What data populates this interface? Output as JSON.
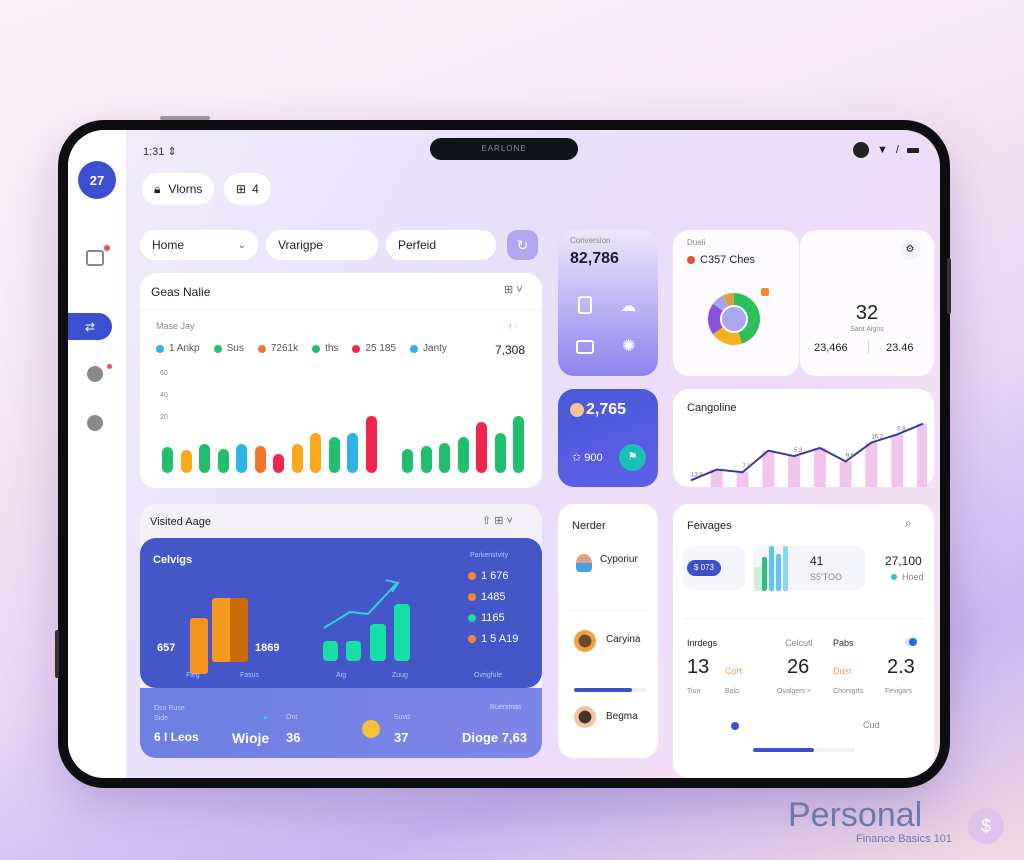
{
  "status_bar": {
    "time": "1:31",
    "notch_label": "EARLONE"
  },
  "sidebar": {
    "avatar_text": "27",
    "items": [
      {
        "icon": "gallery-icon",
        "badge": true
      },
      {
        "icon": "sync-icon",
        "active": true
      },
      {
        "icon": "chat-icon",
        "badge": true
      },
      {
        "icon": "pin-icon"
      }
    ]
  },
  "top_tabs": [
    {
      "label": "Vlorns",
      "icon": "lock-icon"
    },
    {
      "label": "4",
      "icon": "grid-icon"
    }
  ],
  "filters": {
    "home": {
      "label": "Home"
    },
    "vrange": {
      "label": "Vrarigpe"
    },
    "period": {
      "label": "Perfeid"
    }
  },
  "gross_card": {
    "title": "Geas Nalie",
    "subtitle": "Mase Jay",
    "total": "7,308",
    "legend": [
      {
        "label": "1 Ankp",
        "color": "#2cb5e6"
      },
      {
        "label": "Sus",
        "color": "#22c06a"
      },
      {
        "label": "7261k",
        "color": "#f4762a"
      },
      {
        "label": "ths",
        "color": "#22c06a"
      },
      {
        "label": "25 185",
        "color": "#f0264f"
      },
      {
        "label": "Janty",
        "color": "#2cb5e6"
      }
    ],
    "y_ticks": [
      "60",
      "40",
      "20"
    ]
  },
  "chart_data": {
    "type": "bar",
    "title": "Geas Nalie",
    "ylim": [
      0,
      70
    ],
    "groups": [
      {
        "values": [
          18,
          16,
          20,
          17,
          20,
          19,
          13,
          20,
          28,
          25,
          28,
          40
        ],
        "colors": [
          "#1fbf6e",
          "#f7a81b",
          "#1fbf6e",
          "#1fbf6e",
          "#2cb5e6",
          "#f4762a",
          "#f0264f",
          "#f7a81b",
          "#f7a81b",
          "#1fbf6e",
          "#2cb5e6",
          "#f0264f"
        ]
      },
      {
        "values": [
          17,
          19,
          21,
          25,
          36,
          28,
          40
        ],
        "colors": [
          "#1fbf6e",
          "#1fbf6e",
          "#1fbf6e",
          "#1fbf6e",
          "#f0264f",
          "#1fbf6e",
          "#1fbf6e"
        ]
      }
    ]
  },
  "conversion_card": {
    "label": "Conversion",
    "value": "82,786"
  },
  "donut_card": {
    "label": "Dueli",
    "title": "C357 Ches",
    "segments": [
      {
        "value": 45,
        "color": "#2fbf5a"
      },
      {
        "value": 20,
        "color": "#f7b21d"
      },
      {
        "value": 20,
        "color": "#8b4fe0"
      },
      {
        "value": 8,
        "color": "#a8a4f0"
      },
      {
        "value": 7,
        "color": "#d9a23a"
      }
    ]
  },
  "stat_card": {
    "value": "32",
    "caption": "Sant Aigns",
    "left": "23,466",
    "right": "23.46"
  },
  "blue_card": {
    "value": "2,765",
    "sub_value": "900"
  },
  "line_card": {
    "title": "Cangoline",
    "points": [
      2,
      10,
      8,
      24,
      20,
      26,
      16,
      30,
      36,
      44
    ],
    "labels": [
      "13.8",
      "7.0",
      "5.8",
      "9.6",
      "16.2",
      "5.8"
    ]
  },
  "visited_card": {
    "title": "Visited Aage",
    "panel_title": "Celvigs",
    "panel_right_caption": "Parkenstvity",
    "left_val": "657",
    "right_val": "1869",
    "captions": [
      "Fleg",
      "Fasus",
      "Aig",
      "Zuug",
      "Ovrigfule"
    ],
    "stats": [
      {
        "value": "1 676",
        "color": "#f28a2c"
      },
      {
        "value": "1485",
        "color": "#f28a2c"
      },
      {
        "value": "1165",
        "color": "#19d9a6"
      },
      {
        "value": "1 5 A19",
        "color": "#f28a2c"
      }
    ],
    "footer": [
      {
        "label": "Dsn Ruse",
        "sub": "Side",
        "value": "6 I Leos"
      },
      {
        "label": "",
        "value": "Wioje"
      },
      {
        "label": "Ont",
        "value": "36"
      },
      {
        "label": "Suvd",
        "value": "37"
      },
      {
        "label": "Ruerxinas",
        "value": "Dioge 7,63"
      }
    ]
  },
  "member_card": {
    "title": "Nerder",
    "members": [
      {
        "name": "Cyporiur"
      },
      {
        "name": "Caryina"
      },
      {
        "name": "Begma"
      }
    ],
    "progress": 0.8
  },
  "fees_card": {
    "title": "Feivages",
    "badge": "$ 073",
    "count": "41",
    "count_sub": "S5'TOO",
    "amount": "27,100",
    "amount_sub": "Hoed",
    "metrics_header": [
      "Inrdegs",
      "Celcutl",
      "Pabs"
    ],
    "metrics": [
      {
        "value": "13",
        "tag": "Cort",
        "sub1": "Tiun",
        "sub2": "Balo"
      },
      {
        "value": "26",
        "tag": "Dust",
        "sub1": "Ovalgers >",
        "sub2": "Chorsgrts"
      },
      {
        "value": "2.3",
        "tag": "",
        "sub1": "Fevigars",
        "sub2": ""
      }
    ],
    "footer_label": "Cud",
    "progress": 0.6
  },
  "watermark": {
    "title": "Personal",
    "subtitle": "Finance Basics 101"
  }
}
